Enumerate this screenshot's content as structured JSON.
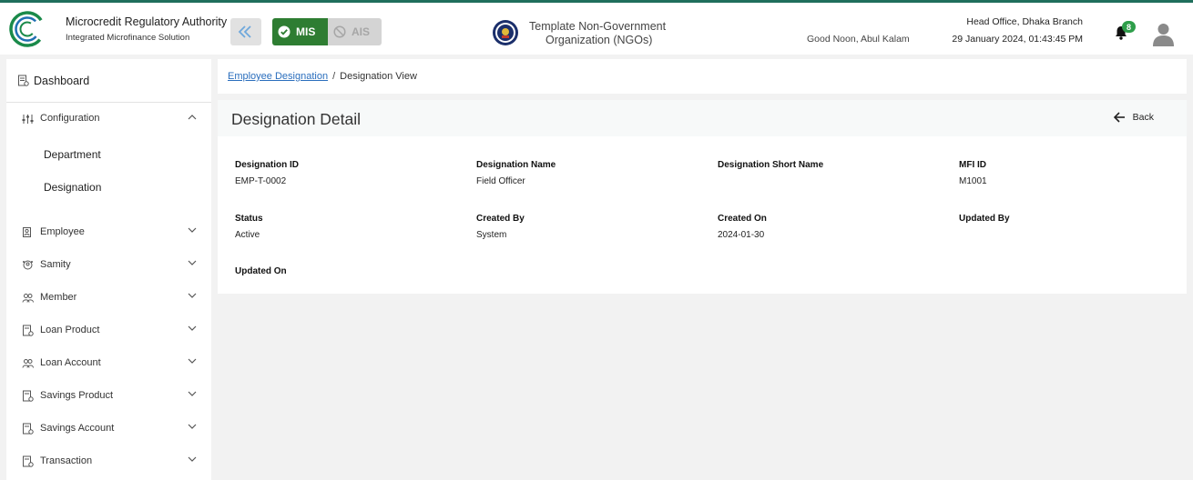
{
  "header": {
    "org_title": "Microcredit Regulatory Authority",
    "org_subtitle": "Integrated Microfinance Solution",
    "logo_text": "Microcredit Regulatory Authority",
    "modules": {
      "mis": "MIS",
      "ais": "AIS"
    },
    "ngo_line1": "Template Non-Government",
    "ngo_line2": "Organization (NGOs)",
    "greeting": "Good Noon, Abul Kalam",
    "branch": "Head Office, Dhaka Branch",
    "datetime": "29 January 2024, 01:43:45 PM",
    "notification_count": "8"
  },
  "sidebar": {
    "dashboard": "Dashboard",
    "configuration": "Configuration",
    "sub_items": [
      "Department",
      "Designation"
    ],
    "items": [
      {
        "label": "Employee",
        "icon": "employee-icon"
      },
      {
        "label": "Samity",
        "icon": "samity-icon"
      },
      {
        "label": "Member",
        "icon": "member-icon"
      },
      {
        "label": "Loan Product",
        "icon": "loan-product-icon"
      },
      {
        "label": "Loan Account",
        "icon": "loan-account-icon"
      },
      {
        "label": "Savings Product",
        "icon": "savings-product-icon"
      },
      {
        "label": "Savings Account",
        "icon": "savings-account-icon"
      },
      {
        "label": "Transaction",
        "icon": "transaction-icon"
      }
    ]
  },
  "breadcrumb": {
    "link": "Employee Designation",
    "separator": "/",
    "current": "Designation View"
  },
  "detail": {
    "title": "Designation Detail",
    "back": "Back",
    "fields": [
      {
        "label": "Designation ID",
        "value": "EMP-T-0002"
      },
      {
        "label": "Designation Name",
        "value": "Field Officer"
      },
      {
        "label": "Designation Short Name",
        "value": ""
      },
      {
        "label": "MFI ID",
        "value": "M1001"
      },
      {
        "label": "Status",
        "value": "Active"
      },
      {
        "label": "Created By",
        "value": "System"
      },
      {
        "label": "Created On",
        "value": "2024-01-30"
      },
      {
        "label": "Updated By",
        "value": ""
      },
      {
        "label": "Updated On",
        "value": ""
      }
    ]
  },
  "colors": {
    "mis_active": "#2e7d32",
    "link": "#2a6ebd",
    "badge": "#2e9e4a",
    "top_accent": "#1f6f5c"
  }
}
